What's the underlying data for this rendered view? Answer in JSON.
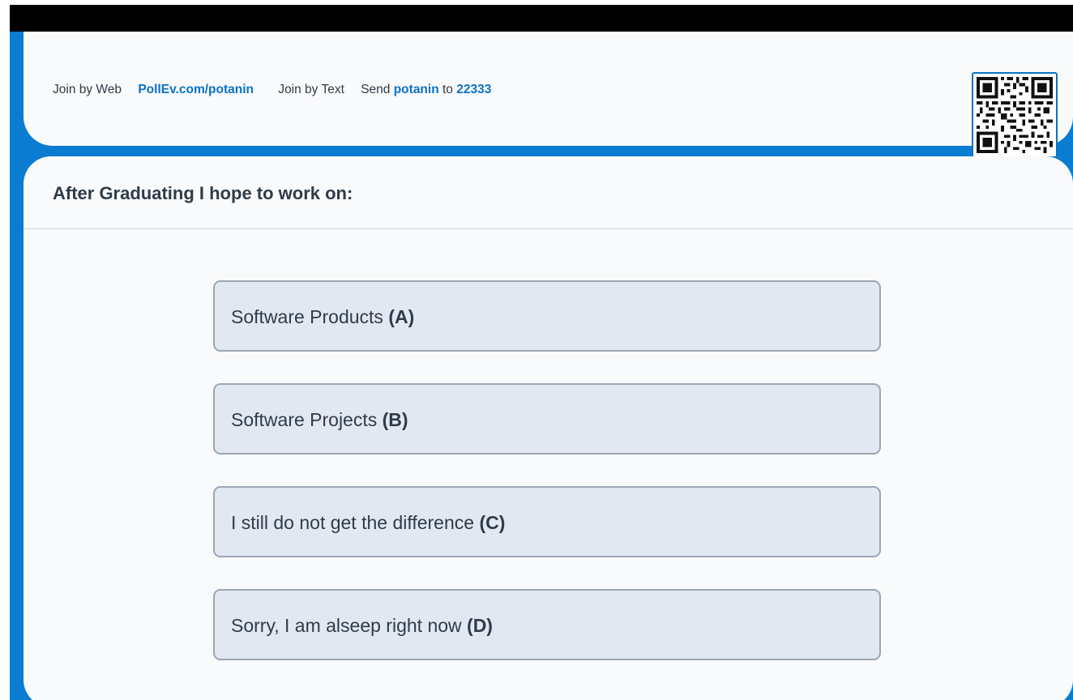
{
  "header": {
    "join_web_label": "Join by Web",
    "join_web_url": "PollEv.com/potanin",
    "join_text_label": "Join by Text",
    "send_prefix": "Send",
    "keyword": "potanin",
    "to_word": "to",
    "number": "22333"
  },
  "poll": {
    "question": "After Graduating I hope to work on:",
    "options": [
      {
        "text": "Software Products",
        "key": "(A)"
      },
      {
        "text": "Software Projects",
        "key": "(B)"
      },
      {
        "text": "I still do not get the difference",
        "key": "(C)"
      },
      {
        "text": "Sorry, I am alseep right now",
        "key": "(D)"
      }
    ]
  },
  "colors": {
    "accent": "#0a7cd2",
    "link": "#0a72c6",
    "text": "#2f3b4a",
    "option_bg": "#e2e8f1",
    "option_border": "#9aa6b5"
  },
  "icons": {
    "qr": "qr-code-icon"
  }
}
